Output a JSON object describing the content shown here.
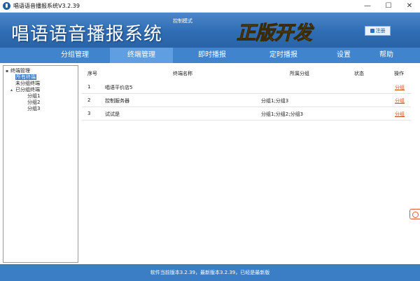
{
  "window": {
    "title": "唱语语音播报系统V3.2.39",
    "min_glyph": "—",
    "max_glyph": "☐",
    "close_glyph": "✕"
  },
  "header": {
    "app_title": "唱语语音播报系统",
    "mode_label": "控制模式",
    "badge_text": "正版开发",
    "register_label": "注册"
  },
  "nav": {
    "tabs": [
      {
        "label": "分组管理"
      },
      {
        "label": "终端管理"
      },
      {
        "label": "即时播报"
      },
      {
        "label": "定时播报"
      },
      {
        "label": "设置"
      },
      {
        "label": "帮助"
      }
    ],
    "active_index": 1
  },
  "tree": {
    "root": {
      "label": "终端管理",
      "expander": "▪"
    },
    "all": {
      "label": "所有终端"
    },
    "ungrouped": {
      "label": "未分组终端"
    },
    "grouped": {
      "label": "已分组终端",
      "expander": "▴"
    },
    "groups": [
      {
        "label": "分组1"
      },
      {
        "label": "分组2"
      },
      {
        "label": "分组3"
      }
    ]
  },
  "table": {
    "columns": {
      "index": "序号",
      "name": "终端名称",
      "group": "所属分组",
      "status": "状态",
      "action": "操作"
    },
    "rows": [
      {
        "index": "1",
        "name": "唱语平价店5",
        "group": "",
        "status": "",
        "action": "分组"
      },
      {
        "index": "2",
        "name": "控制服务器",
        "group": "分组1;分组3",
        "status": "",
        "action": "分组"
      },
      {
        "index": "3",
        "name": "试试是",
        "group": "分组1;分组2;分组3",
        "status": "",
        "action": "分组"
      }
    ]
  },
  "status_bar": {
    "text": "软件当前版本3.2.39，最新版本3.2.39，已经是最新版"
  },
  "colors": {
    "header_blue": "#2f6db4",
    "nav_blue": "#3f84cc",
    "nav_active": "#5f9ee0",
    "link_orange": "#d25a1e",
    "badge_gold": "#f3b51c"
  }
}
